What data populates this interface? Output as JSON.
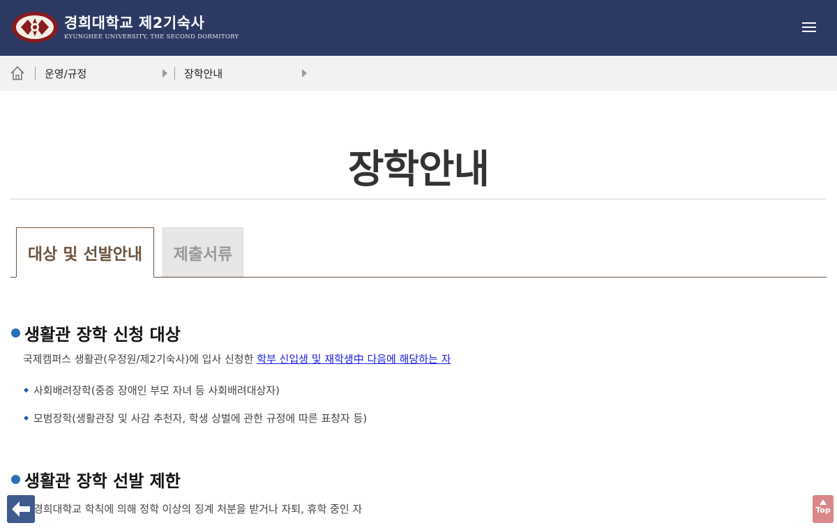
{
  "header": {
    "logo_main": "경희대학교 제2기숙사",
    "logo_sub": "KYUNGHEE UNIVERSITY, THE SECOND DORMITORY"
  },
  "breadcrumb": {
    "level1": "운영/규정",
    "level2": "장학안내"
  },
  "page": {
    "title": "장학안내"
  },
  "tabs": [
    {
      "label": "대상 및 선발안내",
      "active": true
    },
    {
      "label": "제출서류",
      "active": false
    }
  ],
  "sections": [
    {
      "heading": "생활관 장학 신청 대상",
      "desc_prefix": "국제캠퍼스 생활관(우정원/제2기숙사)에 입사 신청한 ",
      "desc_link": "학부 신입생 및 재학생中 다음에 해당하는 자",
      "items": [
        "사회배려장학(중증 장애인 부모 자녀 등 사회배려대상자)",
        "모범장학(생활관장 및 사감 추천자, 학생 상벌에 관한 규정에 따른 표창자 등)"
      ]
    },
    {
      "heading": "생활관 장학 선발 제한",
      "items": [
        "경희대학교 학칙에 의해 정학 이상의 징계 처분을 받거나 자퇴, 휴학 중인 자"
      ]
    }
  ],
  "floating": {
    "top_label": "Top"
  },
  "colors": {
    "header_bg": "#2c3a63",
    "tab_accent": "#6b5440",
    "section_dot": "#2a6fb5",
    "link": "#1a1ae0"
  }
}
